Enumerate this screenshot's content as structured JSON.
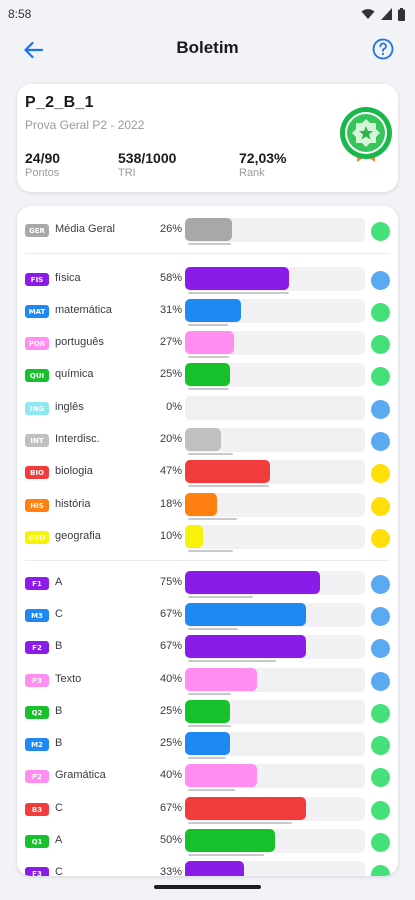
{
  "status_bar": {
    "time": "8:58"
  },
  "app_bar": {
    "title": "Boletim"
  },
  "summary": {
    "code": "P_2_B_1",
    "exam": "Prova Geral P2 -  2022",
    "stats": [
      {
        "value": "24/90",
        "label": "Pontos"
      },
      {
        "value": "538/1000",
        "label": "TRI"
      },
      {
        "value": "72,03%",
        "label": "Rank"
      }
    ]
  },
  "rows": [
    {
      "code": "GER",
      "name": "Média Geral",
      "pct": "26%",
      "value": 26,
      "color": "#a8a8a8",
      "dot": "#45e07a",
      "under": 24
    },
    {
      "code": "FIS",
      "name": "física",
      "pct": "58%",
      "value": 58,
      "color": "#8a1be8",
      "dot": "#5aaaf2",
      "under": 56
    },
    {
      "code": "MAT",
      "name": "matemática",
      "pct": "31%",
      "value": 31,
      "color": "#1f88f2",
      "dot": "#45e07a",
      "under": 22
    },
    {
      "code": "POR",
      "name": "português",
      "pct": "27%",
      "value": 27,
      "color": "#ff8ef0",
      "dot": "#45e07a",
      "under": 23
    },
    {
      "code": "QUI",
      "name": "química",
      "pct": "25%",
      "value": 25,
      "color": "#17c12b",
      "dot": "#45e07a",
      "under": 23
    },
    {
      "code": "ING",
      "name": "inglês",
      "pct": "0%",
      "value": 0,
      "color": "#8ce8f2",
      "dot": "#5aaaf2",
      "under": 0
    },
    {
      "code": "INT",
      "name": "Interdisc.",
      "pct": "20%",
      "value": 20,
      "color": "#c0c0c0",
      "dot": "#5aaaf2",
      "under": 25
    },
    {
      "code": "BIO",
      "name": "biologia",
      "pct": "47%",
      "value": 47,
      "color": "#f23b3b",
      "dot": "#ffde0a",
      "under": 45
    },
    {
      "code": "HIS",
      "name": "história",
      "pct": "18%",
      "value": 18,
      "color": "#ff7f10",
      "dot": "#ffde0a",
      "under": 27
    },
    {
      "code": "GEO",
      "name": "geografia",
      "pct": "10%",
      "value": 10,
      "color": "#f7f20a",
      "dot": "#ffde0a",
      "under": 25
    },
    {
      "code": "F1",
      "name": "A",
      "pct": "75%",
      "value": 75,
      "color": "#8a1be8",
      "dot": "#5aaaf2",
      "under": 36
    },
    {
      "code": "M3",
      "name": "C",
      "pct": "67%",
      "value": 67,
      "color": "#1f88f2",
      "dot": "#5aaaf2",
      "under": 28
    },
    {
      "code": "F2",
      "name": "B",
      "pct": "67%",
      "value": 67,
      "color": "#8a1be8",
      "dot": "#5aaaf2",
      "under": 49
    },
    {
      "code": "P3",
      "name": "Texto",
      "pct": "40%",
      "value": 40,
      "color": "#ff8ef0",
      "dot": "#5aaaf2",
      "under": 24
    },
    {
      "code": "Q2",
      "name": "B",
      "pct": "25%",
      "value": 25,
      "color": "#17c12b",
      "dot": "#45e07a",
      "under": 24
    },
    {
      "code": "M2",
      "name": "B",
      "pct": "25%",
      "value": 25,
      "color": "#1f88f2",
      "dot": "#45e07a",
      "under": 21
    },
    {
      "code": "P2",
      "name": "Gramática",
      "pct": "40%",
      "value": 40,
      "color": "#ff8ef0",
      "dot": "#45e07a",
      "under": 26
    },
    {
      "code": "B3",
      "name": "C",
      "pct": "67%",
      "value": 67,
      "color": "#f23b3b",
      "dot": "#45e07a",
      "under": 58
    },
    {
      "code": "Q1",
      "name": "A",
      "pct": "50%",
      "value": 50,
      "color": "#17c12b",
      "dot": "#45e07a",
      "under": 42
    },
    {
      "code": "F3",
      "name": "C",
      "pct": "33%",
      "value": 33,
      "color": "#8a1be8",
      "dot": "#45e07a",
      "under": 20
    }
  ]
}
